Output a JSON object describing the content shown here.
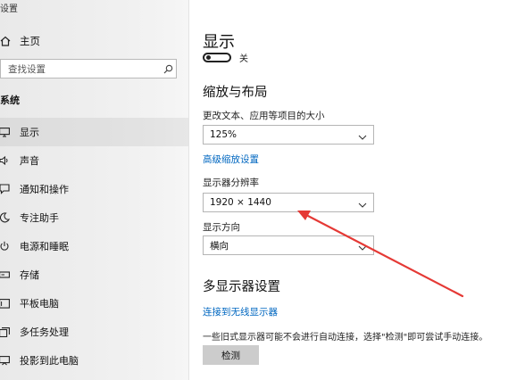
{
  "window": {
    "title": "设置"
  },
  "sidebar": {
    "home_label": "主页",
    "search_placeholder": "查找设置",
    "section_label": "系统",
    "items": [
      {
        "label": "显示",
        "icon": "monitor-icon",
        "active": true
      },
      {
        "label": "声音",
        "icon": "speaker-icon"
      },
      {
        "label": "通知和操作",
        "icon": "notification-icon"
      },
      {
        "label": "专注助手",
        "icon": "moon-icon"
      },
      {
        "label": "电源和睡眠",
        "icon": "power-icon"
      },
      {
        "label": "存储",
        "icon": "storage-icon"
      },
      {
        "label": "平板电脑",
        "icon": "tablet-icon"
      },
      {
        "label": "多任务处理",
        "icon": "multitask-icon"
      },
      {
        "label": "投影到此电脑",
        "icon": "project-icon"
      }
    ]
  },
  "main": {
    "title": "显示",
    "night_light": {
      "state_text": "关",
      "on": false
    },
    "scale_section": {
      "heading": "缩放与布局",
      "text_size_label": "更改文本、应用等项目的大小",
      "text_size_value": "125%",
      "advanced_link": "高级缩放设置",
      "resolution_label": "显示器分辨率",
      "resolution_value": "1920 × 1440",
      "orientation_label": "显示方向",
      "orientation_value": "横向"
    },
    "multi_display": {
      "heading": "多显示器设置",
      "wireless_link": "连接到无线显示器",
      "note": "一些旧式显示器可能不会进行自动连接，选择\"检测\"即可尝试手动连接。",
      "detect_button": "检测"
    }
  },
  "colors": {
    "accent": "#0067c0",
    "annotation_arrow": "#e53935"
  }
}
